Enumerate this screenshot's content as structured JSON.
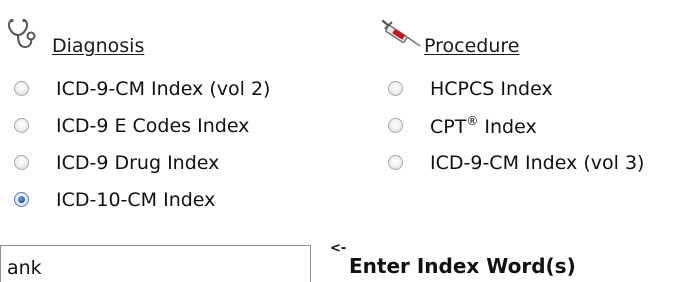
{
  "diagnosis": {
    "heading": "Diagnosis",
    "icon": "stethoscope-icon",
    "options": [
      {
        "label": "ICD-9-CM Index (vol 2)",
        "checked": false
      },
      {
        "label": "ICD-9 E Codes Index",
        "checked": false
      },
      {
        "label": "ICD-9 Drug Index",
        "checked": false
      },
      {
        "label": "ICD-10-CM Index",
        "checked": true
      }
    ]
  },
  "procedure": {
    "heading": "Procedure",
    "icon": "syringe-icon",
    "options": [
      {
        "label": "HCPCS Index",
        "checked": false
      },
      {
        "label": "CPT",
        "sup": "®",
        "suffix": " Index",
        "checked": false
      },
      {
        "label": "ICD-9-CM Index (vol 3)",
        "checked": false
      }
    ]
  },
  "search": {
    "value": "ank",
    "arrow": "<-",
    "label": "Enter Index Word(s)"
  },
  "colors": {
    "radio_selected": "#1e57a9",
    "text": "#111111"
  }
}
